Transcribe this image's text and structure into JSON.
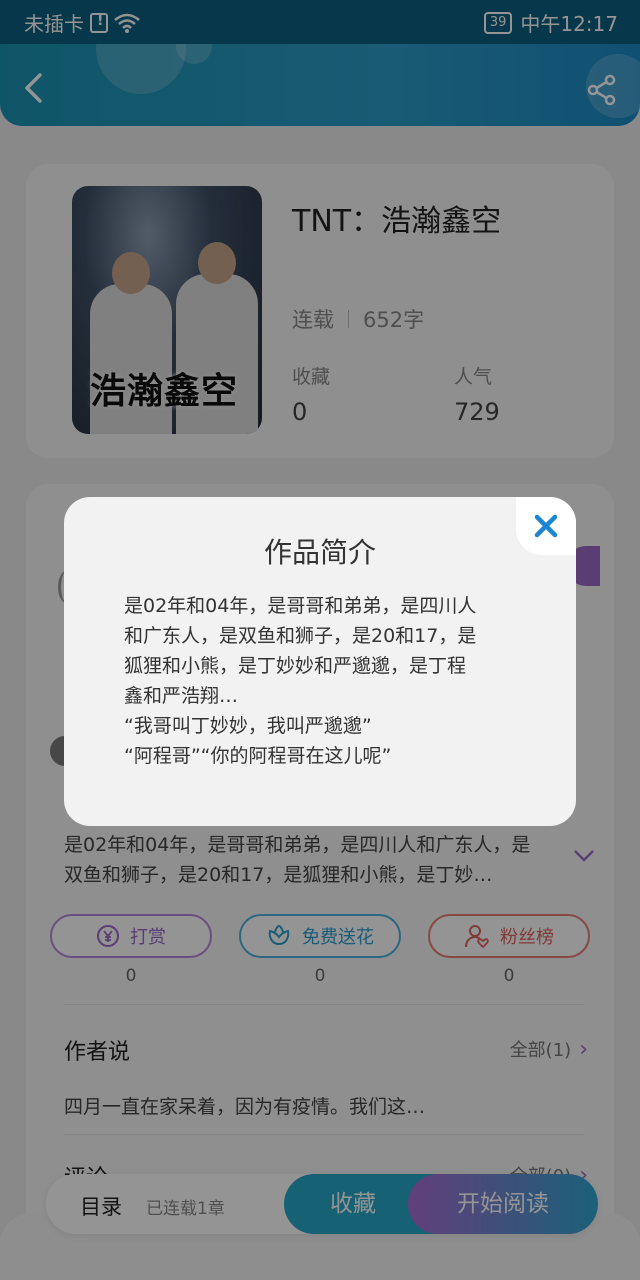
{
  "status_bar": {
    "carrier": "未插卡",
    "battery": "39",
    "time": "中午12:17"
  },
  "book": {
    "title": "TNT：浩瀚鑫空",
    "cover_text": "浩瀚鑫空",
    "status": "连载",
    "word_count": "652字",
    "favorites_label": "收藏",
    "favorites_value": "0",
    "popularity_label": "人气",
    "popularity_value": "729"
  },
  "intro_preview": "是02年和04年，是哥哥和弟弟，是四川人和广东人，是双鱼和狮子，是20和17，是狐狸和小熊，是丁妙…",
  "actions": [
    {
      "label": "打赏",
      "count": "0",
      "icon": "yen-icon"
    },
    {
      "label": "免费送花",
      "count": "0",
      "icon": "flower-icon"
    },
    {
      "label": "粉丝榜",
      "count": "0",
      "icon": "fan-user-icon"
    }
  ],
  "author_says": {
    "title": "作者说",
    "more": "全部(1)",
    "text": "四月一直在家呆着，因为有疫情。我们这…"
  },
  "comments": {
    "title": "评论",
    "more": "全部(0)"
  },
  "bottom_bar": {
    "toc": "目录",
    "toc_sub": "已连载1章",
    "favorite": "收藏",
    "start_reading": "开始阅读"
  },
  "modal": {
    "title": "作品简介",
    "lines": [
      "是02年和04年，是哥哥和弟弟，是四川人",
      "和广东人，是双鱼和狮子，是20和17，是",
      "狐狸和小熊，是丁妙妙和严邈邈，是丁程",
      "鑫和严浩翔…",
      "“我哥叫丁妙妙，我叫严邈邈”",
      "“阿程哥”“你的阿程哥在这儿呢”"
    ]
  }
}
